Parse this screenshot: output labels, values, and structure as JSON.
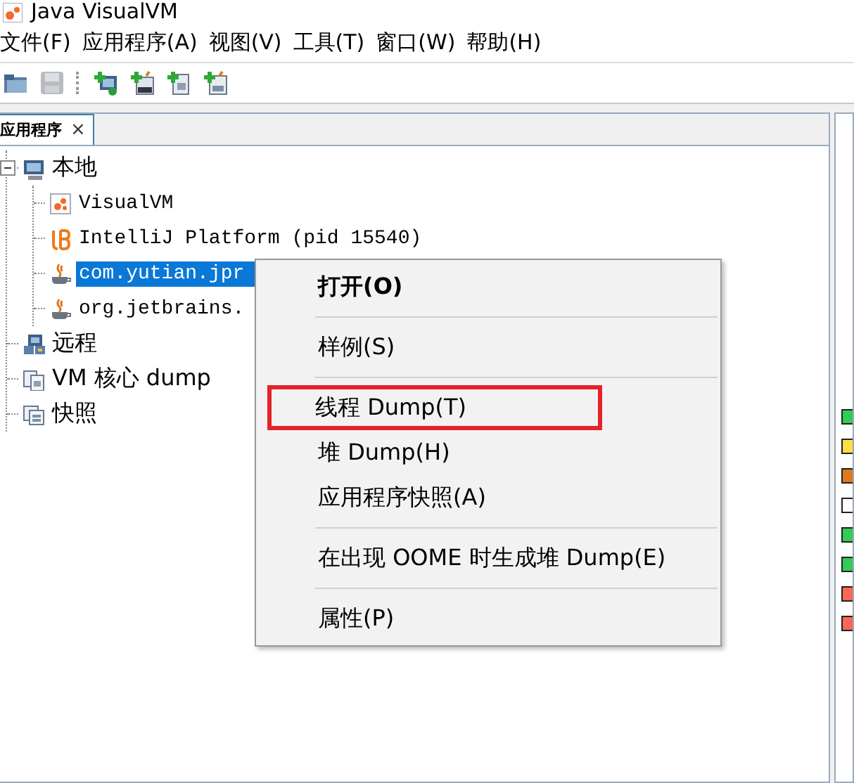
{
  "window": {
    "title": "Java VisualVM"
  },
  "menu_bar": [
    "文件(F)",
    "应用程序(A)",
    "视图(V)",
    "工具(T)",
    "窗口(W)",
    "帮助(H)"
  ],
  "toolbar": [
    {
      "kind": "open",
      "disabled": false
    },
    {
      "kind": "save",
      "disabled": true
    },
    {
      "kind": "add-host",
      "disabled": false
    },
    {
      "kind": "add-jmx",
      "disabled": false
    },
    {
      "kind": "add-coredump",
      "disabled": false
    },
    {
      "kind": "add-snapshot",
      "disabled": false
    }
  ],
  "tab": {
    "label": "应用程序",
    "selected": true,
    "close": "×"
  },
  "tree": [
    {
      "label": "本地",
      "kind": "host",
      "expanded": true,
      "selected": false,
      "children": [
        {
          "label": "VisualVM",
          "kind": "visualvm",
          "selected": false
        },
        {
          "label": "IntelliJ Platform (pid 15540)",
          "kind": "intellij",
          "selected": false
        },
        {
          "label": "com.yutian.jpr",
          "kind": "java",
          "selected": true
        },
        {
          "label": "org.jetbrains.",
          "kind": "java",
          "selected": false
        }
      ]
    },
    {
      "label": "远程",
      "kind": "remote",
      "selected": false
    },
    {
      "label": "VM 核心 dump",
      "kind": "coredump",
      "selected": false
    },
    {
      "label": "快照",
      "kind": "snapshot",
      "selected": false
    }
  ],
  "context_menu": {
    "items": [
      {
        "kind": "item",
        "label": "打开(O)",
        "bold": true,
        "marked": false
      },
      {
        "kind": "separator"
      },
      {
        "kind": "item",
        "label": "样例(S)",
        "bold": false,
        "marked": false
      },
      {
        "kind": "separator"
      },
      {
        "kind": "item",
        "label": "线程 Dump(T)",
        "bold": false,
        "marked": true
      },
      {
        "kind": "item",
        "label": "堆 Dump(H)",
        "bold": false,
        "marked": false
      },
      {
        "kind": "item",
        "label": "应用程序快照(A)",
        "bold": false,
        "marked": false
      },
      {
        "kind": "separator"
      },
      {
        "kind": "item",
        "label": "在出现 OOME 时生成堆 Dump(E)",
        "bold": false,
        "marked": false
      },
      {
        "kind": "separator"
      },
      {
        "kind": "item",
        "label": "属性(P)",
        "bold": false,
        "marked": false
      }
    ]
  },
  "side_panel": {
    "legend": [
      {
        "color": "#33cc55"
      },
      {
        "color": "#ffdd44"
      },
      {
        "color": "#e07820"
      },
      {
        "color": "#ffffff"
      },
      {
        "color": "#33cc55"
      },
      {
        "color": "#33cc55"
      },
      {
        "color": "#ff6655"
      },
      {
        "color": "#ff6655"
      }
    ]
  }
}
